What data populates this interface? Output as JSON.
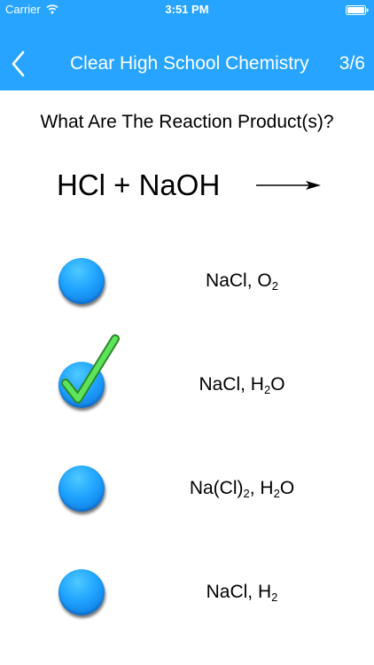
{
  "status": {
    "carrier": "Carrier",
    "time": "3:51 PM"
  },
  "nav": {
    "title": "Clear High School Chemistry",
    "progress": "3/6"
  },
  "question": "What Are The Reaction Product(s)?",
  "reaction": {
    "equation": "HCl + NaOH"
  },
  "options": [
    {
      "parts": [
        "NaCl, O",
        "2",
        ""
      ],
      "selected": false
    },
    {
      "parts": [
        "NaCl, H",
        "2",
        "O"
      ],
      "selected": true
    },
    {
      "parts": [
        "Na(Cl)",
        "2",
        ", H",
        "2",
        "O"
      ],
      "selected": false
    },
    {
      "parts": [
        "NaCl, H",
        "2",
        ""
      ],
      "selected": false
    }
  ],
  "colors": {
    "header": "#27a4ff",
    "radio": "#1fa3ff",
    "check": "#5ee35a"
  }
}
